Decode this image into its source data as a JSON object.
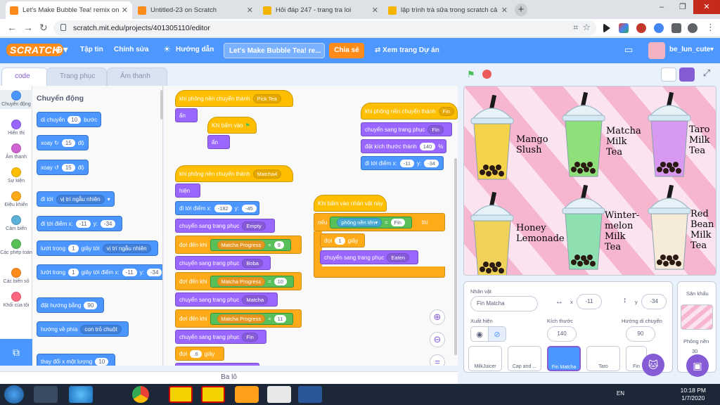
{
  "browser": {
    "tabs": [
      {
        "title": "Let's Make Bubble Tea! remix on",
        "active": true,
        "color": "#ff8c1a"
      },
      {
        "title": "Untitled-23 on Scratch",
        "active": false,
        "color": "#ff8c1a"
      },
      {
        "title": "Hỏi đáp 247 - trang tra loi",
        "active": false,
        "color": "#f4b400"
      },
      {
        "title": "lập trình trà sữa trong scratch cả",
        "active": false,
        "color": "#f4b400"
      }
    ],
    "new_tab": "+",
    "url": "scratch.mit.edu/projects/401305110/editor",
    "window_controls": [
      "–",
      "❐",
      "✕"
    ]
  },
  "menu": {
    "logo": "SCRATCH",
    "file": "Tập tin",
    "edit": "Chỉnh sửa",
    "tutorials": "Hướng dẫn",
    "project_title": "Let's Make Bubble Tea! re...",
    "share": "Chia sẻ",
    "see_project": "Xem trang Dự án",
    "username": "be_lun_cute"
  },
  "editor_tabs": {
    "code": "code",
    "costumes": "Trang phục",
    "sounds": "Âm thanh"
  },
  "categories": [
    {
      "label": "Chuyển động",
      "color": "#4c97ff"
    },
    {
      "label": "Hiển thị",
      "color": "#9966ff"
    },
    {
      "label": "Âm thanh",
      "color": "#cf63cf"
    },
    {
      "label": "Sự kiện",
      "color": "#ffbf00"
    },
    {
      "label": "Điều khiển",
      "color": "#ffab19"
    },
    {
      "label": "Cảm biến",
      "color": "#5cb1d6"
    },
    {
      "label": "Các phép toán",
      "color": "#59c059"
    },
    {
      "label": "Các biến số",
      "color": "#ff8c1a"
    },
    {
      "label": "Khối của tôi",
      "color": "#ff6680"
    }
  ],
  "palette": {
    "heading": "Chuyển động",
    "blocks": [
      {
        "text": "di chuyển",
        "v1": "10",
        "after": "bước"
      },
      {
        "text": "xoay ↻",
        "v1": "15",
        "after": "độ"
      },
      {
        "text": "xoay ↺",
        "v1": "15",
        "after": "độ"
      },
      {
        "text": "đi tới",
        "dd": "vị trí ngẫu nhiên"
      },
      {
        "text": "đi tới điểm x:",
        "v1": "-11",
        "mid": "y:",
        "v2": "-34"
      },
      {
        "text": "lướt trong",
        "v1": "1",
        "mid": "giây tới",
        "dd": "vị trí ngẫu nhiên"
      },
      {
        "text": "lướt trong",
        "v1": "1",
        "mid": "giây tới điểm x:",
        "v2": "-11",
        "mid2": "y:",
        "v3": "-34"
      },
      {
        "text": "đặt hướng bằng",
        "v1": "90"
      },
      {
        "text": "hướng về phía",
        "dd": "con trỏ chuột"
      },
      {
        "text": "thay đổi x một lượng",
        "v1": "10"
      }
    ]
  },
  "scripts": {
    "s1": {
      "hat": "khi phông nền chuyển thành",
      "hat_dd": "Pick Tea",
      "b1": "ẩn"
    },
    "s2": {
      "hat": "Khi bấm vào",
      "b1": "ẩn"
    },
    "s3": {
      "hat": "khi phông nền chuyển thành",
      "hat_dd": "Matcha4",
      "show": "hiện",
      "goto": "đi tới điểm x:",
      "x": "-182",
      "y_lbl": "y:",
      "y": "-45",
      "cost1": "chuyển sang trang phục",
      "cost1_v": "Empty",
      "wait1": "đợi đến khi",
      "var": "Matcha Progress",
      "eq": "=",
      "w1v": "9",
      "cost2_v": "Boba",
      "w2v": "10",
      "cost3_v": "Matcha",
      "w3v": "11",
      "cost4_v": "Fin",
      "wait": "đợi",
      "wait_v": ".6",
      "wait_unit": "giây"
    },
    "s4": {
      "hat": "khi phông nền chuyển thành",
      "hat_dd": "Fin",
      "cost": "chuyển sang trang phục",
      "cost_v": "Fin",
      "size": "đặt kích thước thành",
      "size_v": "140",
      "size_unit": "%",
      "goto": "đi tới điểm x:",
      "x": "-11",
      "y_lbl": "y:",
      "y": "-34"
    },
    "s5": {
      "hat": "Khi bấm vào nhân vật này",
      "if": "nếu",
      "then": "thì",
      "sensor": "phông nền",
      "prop": "tên",
      "eq": "=",
      "val": "Fin",
      "wait": "đợi",
      "wait_v": "1",
      "wait_unit": "giây",
      "cost": "chuyển sang trang phục",
      "cost_v": "Eaten"
    }
  },
  "stage_drinks": [
    {
      "name": "Mango\nSlush",
      "color": "#f4d34a"
    },
    {
      "name": "Matcha\nMilk\nTea",
      "color": "#8fe07a"
    },
    {
      "name": "Taro\nMilk\nTea",
      "color": "#d79af0"
    },
    {
      "name": "Honey\nLemonade",
      "color": "#f0d25a"
    },
    {
      "name": "Winter-\nmelon\nMilk\nTea",
      "color": "#8fe0b0"
    },
    {
      "name": "Red\nBean\nMilk\nTea",
      "color": "#f6ead8"
    }
  ],
  "sprite_info": {
    "sprite_label": "Nhân vật",
    "sprite_name": "Fin Matcha",
    "x_label": "x",
    "x": "-11",
    "y_label": "y",
    "y": "-34",
    "show_label": "Xuất hiện",
    "size_label": "Kích thước",
    "size": "140",
    "dir_label": "Hướng di chuyển",
    "dir": "90"
  },
  "sprites": [
    {
      "name": "MilkJuicer",
      "selected": false
    },
    {
      "name": "Cap and ...",
      "selected": false
    },
    {
      "name": "Fin Matcha",
      "selected": true
    },
    {
      "name": "Taro",
      "selected": false
    },
    {
      "name": "Fin",
      "selected": false
    }
  ],
  "stage_panel": {
    "title": "Sân khấu",
    "backdrops_label": "Phông nền",
    "backdrops_count": "30"
  },
  "backpack": "Ba lô",
  "taskbar": {
    "lang": "EN",
    "time": "10:18 PM",
    "date": "1/7/2020"
  }
}
